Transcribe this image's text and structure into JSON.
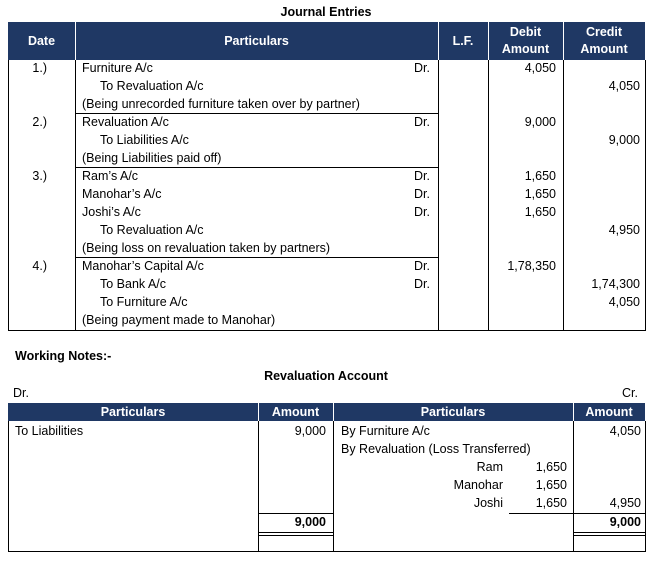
{
  "journal": {
    "title": "Journal Entries",
    "headers": {
      "date": "Date",
      "particulars": "Particulars",
      "lf": "L.F.",
      "debit": "Debit Amount",
      "credit": "Credit Amount"
    },
    "entries": [
      {
        "date": "1.)",
        "lines": [
          {
            "text": "Furniture A/c",
            "dr": "Dr.",
            "debit": "4,050",
            "credit": ""
          },
          {
            "text": "To Revaluation A/c",
            "dr": "",
            "debit": "",
            "credit": "4,050",
            "indent": true
          },
          {
            "text": "(Being unrecorded furniture taken over by partner)",
            "dr": "",
            "debit": "",
            "credit": ""
          }
        ]
      },
      {
        "date": "2.)",
        "lines": [
          {
            "text": "Revaluation A/c",
            "dr": "Dr.",
            "debit": "9,000",
            "credit": ""
          },
          {
            "text": "To Liabilities A/c",
            "dr": "",
            "debit": "",
            "credit": "9,000",
            "indent": true
          },
          {
            "text": "(Being Liabilities paid off)",
            "dr": "",
            "debit": "",
            "credit": ""
          }
        ]
      },
      {
        "date": "3.)",
        "lines": [
          {
            "text": "Ram’s A/c",
            "dr": "Dr.",
            "debit": "1,650",
            "credit": ""
          },
          {
            "text": "Manohar’s A/c",
            "dr": "Dr.",
            "debit": "1,650",
            "credit": ""
          },
          {
            "text": "Joshi’s A/c",
            "dr": "Dr.",
            "debit": "1,650",
            "credit": ""
          },
          {
            "text": "To Revaluation A/c",
            "dr": "",
            "debit": "",
            "credit": "4,950",
            "indent": true
          },
          {
            "text": "(Being loss on revaluation taken by partners)",
            "dr": "",
            "debit": "",
            "credit": ""
          }
        ]
      },
      {
        "date": "4.)",
        "lines": [
          {
            "text": "Manohar’s Capital A/c",
            "dr": "Dr.",
            "debit": "1,78,350",
            "credit": ""
          },
          {
            "text": "To Bank A/c",
            "dr": "Dr.",
            "debit": "",
            "credit": "1,74,300",
            "indent": true
          },
          {
            "text": "To Furniture A/c",
            "dr": "",
            "debit": "",
            "credit": "4,050",
            "indent": true
          },
          {
            "text": "(Being payment made to Manohar)",
            "dr": "",
            "debit": "",
            "credit": ""
          }
        ]
      }
    ]
  },
  "working_notes": {
    "label": "Working Notes:-",
    "account_title": "Revaluation Account",
    "dr_label": "Dr.",
    "cr_label": "Cr.",
    "headers": {
      "particulars_left": "Particulars",
      "amount_left": "Amount",
      "particulars_right": "Particulars",
      "amount_right": "Amount"
    },
    "left": [
      {
        "text": "To Liabilities",
        "amount": "9,000"
      }
    ],
    "right": {
      "furniture": {
        "text": "By Furniture A/c",
        "amount": "4,050"
      },
      "revaluation": "By Revaluation (Loss Transferred)",
      "partners": [
        {
          "name": "Ram",
          "amount": "1,650"
        },
        {
          "name": "Manohar",
          "amount": "1,650"
        },
        {
          "name": "Joshi",
          "amount": "1,650"
        }
      ],
      "partners_total": "4,950"
    },
    "total_left": "9,000",
    "total_right": "9,000"
  }
}
